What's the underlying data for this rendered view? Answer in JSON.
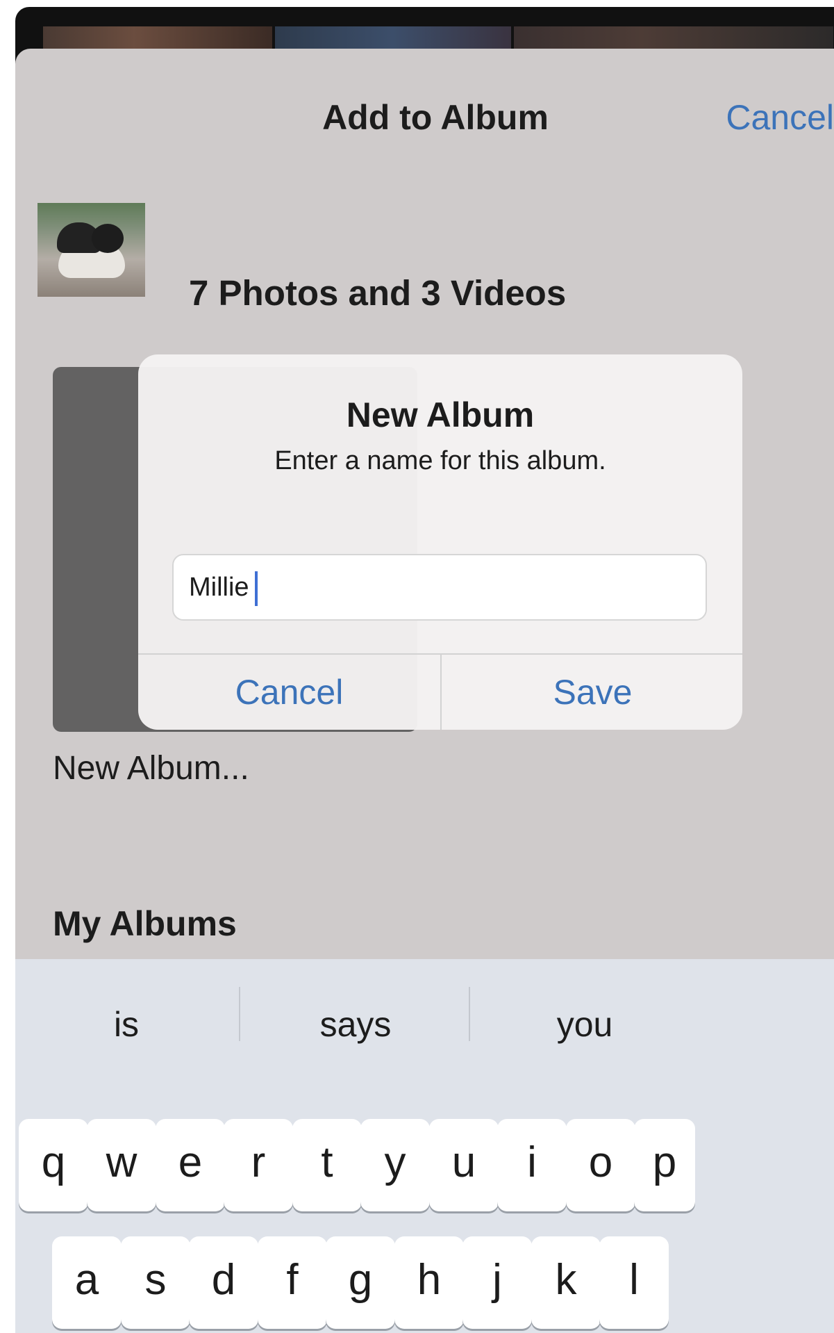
{
  "sheet": {
    "title": "Add to Album",
    "cancel_label": "Cancel",
    "selection_summary": "7 Photos and 3 Videos",
    "new_album_label": "New Album...",
    "my_albums_heading": "My Albums"
  },
  "dialog": {
    "title": "New Album",
    "message": "Enter a name for this album.",
    "input_value": "Millie",
    "cancel_label": "Cancel",
    "save_label": "Save"
  },
  "keyboard": {
    "suggestions": [
      "is",
      "says",
      "you"
    ],
    "row1": [
      "q",
      "w",
      "e",
      "r",
      "t",
      "y",
      "u",
      "i",
      "o",
      "p"
    ],
    "row2": [
      "a",
      "s",
      "d",
      "f",
      "g",
      "h",
      "j",
      "k",
      "l"
    ]
  },
  "colors": {
    "accent": "#3c73b9",
    "sheet_background": "#cfcbcb",
    "keyboard_background": "#dfe3ea"
  }
}
